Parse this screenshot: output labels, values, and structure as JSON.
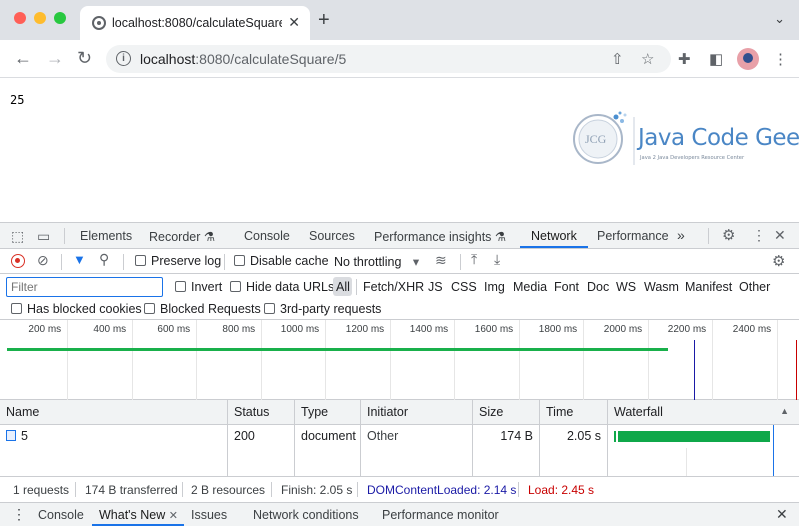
{
  "browser": {
    "tab_title": "localhost:8080/calculateSquare",
    "tab_close": "✕",
    "new_tab": "+",
    "url": "localhost:8080/calculateSquare/5",
    "url_host": "localhost",
    "url_rest": ":8080/calculateSquare/5"
  },
  "page": {
    "result": "25",
    "logo": {
      "badge": "JCG",
      "name": "Java Code Geeks",
      "tagline": "Java 2 Java Developers Resource Center"
    }
  },
  "devtools": {
    "tabs": [
      "Elements",
      "Recorder",
      "Console",
      "Sources",
      "Performance insights",
      "Network",
      "Performance"
    ],
    "active_tab": "Network",
    "more": "»",
    "network_toolbar": {
      "preserve_log": "Preserve log",
      "disable_cache": "Disable cache",
      "throttling": "No throttling"
    },
    "filter": {
      "placeholder": "Filter",
      "invert": "Invert",
      "hide_data_urls": "Hide data URLs",
      "types": [
        "All",
        "Fetch/XHR",
        "JS",
        "CSS",
        "Img",
        "Media",
        "Font",
        "Doc",
        "WS",
        "Wasm",
        "Manifest",
        "Other"
      ],
      "active_type": "All",
      "has_blocked_cookies": "Has blocked cookies",
      "blocked_requests": "Blocked Requests",
      "third_party": "3rd-party requests"
    },
    "overview_ticks": [
      "200 ms",
      "400 ms",
      "600 ms",
      "800 ms",
      "1000 ms",
      "1200 ms",
      "1400 ms",
      "1600 ms",
      "1800 ms",
      "2000 ms",
      "2200 ms",
      "2400 ms"
    ],
    "columns": [
      "Name",
      "Status",
      "Type",
      "Initiator",
      "Size",
      "Time",
      "Waterfall"
    ],
    "rows": [
      {
        "name": "5",
        "status": "200",
        "type": "document",
        "initiator": "Other",
        "size": "174 B",
        "time": "2.05 s"
      }
    ],
    "summary": {
      "requests": "1 requests",
      "transferred": "174 B transferred",
      "resources": "2 B resources",
      "finish": "Finish: 2.05 s",
      "dom_content_loaded": "DOMContentLoaded: 2.14 s",
      "load": "Load: 2.45 s"
    },
    "drawer_tabs": [
      "Console",
      "What's New",
      "Issues",
      "Network conditions",
      "Performance monitor"
    ],
    "colors": {
      "dcl": "#1a1aa6",
      "load": "#c80000",
      "accent": "#1a73e8",
      "bar": "#0fa84a"
    }
  }
}
